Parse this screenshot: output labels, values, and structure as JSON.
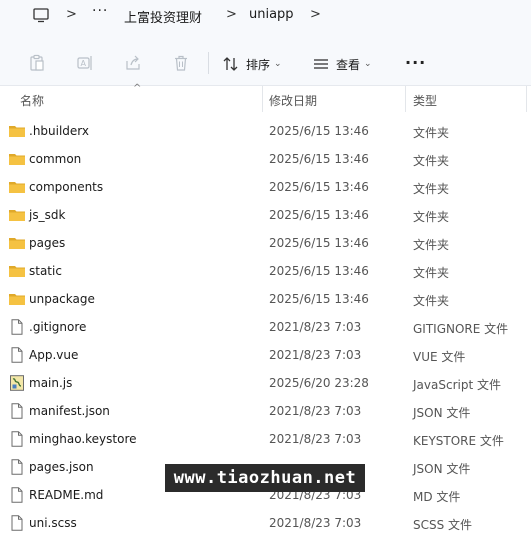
{
  "breadcrumb": {
    "more": "···",
    "sep": ">",
    "items": [
      "上富投资理财",
      "uniapp"
    ]
  },
  "toolbar": {
    "sort_label": "排序",
    "view_label": "查看",
    "more_label": "···"
  },
  "columns": {
    "name": "名称",
    "date": "修改日期",
    "type": "类型"
  },
  "files": [
    {
      "name": ".hbuilderx",
      "date": "2025/6/15 13:46",
      "type": "文件夹",
      "icon": "folder-icon"
    },
    {
      "name": "common",
      "date": "2025/6/15 13:46",
      "type": "文件夹",
      "icon": "folder-icon"
    },
    {
      "name": "components",
      "date": "2025/6/15 13:46",
      "type": "文件夹",
      "icon": "folder-icon"
    },
    {
      "name": "js_sdk",
      "date": "2025/6/15 13:46",
      "type": "文件夹",
      "icon": "folder-icon"
    },
    {
      "name": "pages",
      "date": "2025/6/15 13:46",
      "type": "文件夹",
      "icon": "folder-icon"
    },
    {
      "name": "static",
      "date": "2025/6/15 13:46",
      "type": "文件夹",
      "icon": "folder-icon"
    },
    {
      "name": "unpackage",
      "date": "2025/6/15 13:46",
      "type": "文件夹",
      "icon": "folder-icon"
    },
    {
      "name": ".gitignore",
      "date": "2021/8/23 7:03",
      "type": "GITIGNORE 文件",
      "icon": "file-icon"
    },
    {
      "name": "App.vue",
      "date": "2021/8/23 7:03",
      "type": "VUE 文件",
      "icon": "file-icon"
    },
    {
      "name": "main.js",
      "date": "2025/6/20 23:28",
      "type": "JavaScript 文件",
      "icon": "script-file-icon"
    },
    {
      "name": "manifest.json",
      "date": "2021/8/23 7:03",
      "type": "JSON 文件",
      "icon": "file-icon"
    },
    {
      "name": "minghao.keystore",
      "date": "2021/8/23 7:03",
      "type": "KEYSTORE 文件",
      "icon": "file-icon"
    },
    {
      "name": "pages.json",
      "date": "",
      "type": "JSON 文件",
      "icon": "file-icon"
    },
    {
      "name": "README.md",
      "date": "2021/8/23 7:03",
      "type": "MD 文件",
      "icon": "file-icon"
    },
    {
      "name": "uni.scss",
      "date": "2021/8/23 7:03",
      "type": "SCSS 文件",
      "icon": "file-icon"
    }
  ],
  "watermark": "www.tiaozhuan.net",
  "colors": {
    "folder": "#f5c242",
    "folder_dark": "#e0a92a",
    "chrome": "#f7f9fc"
  }
}
